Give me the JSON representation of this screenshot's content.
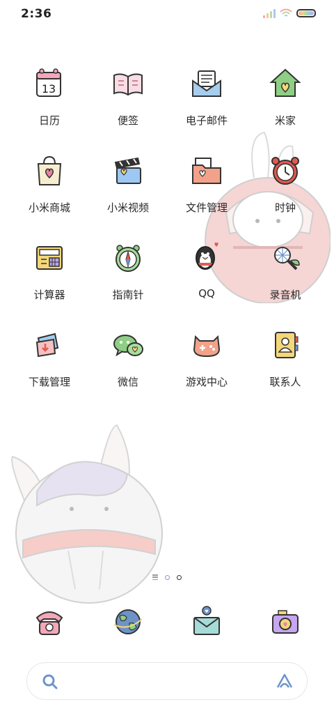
{
  "status_bar": {
    "time": "2:36",
    "icons": [
      "signal-icon",
      "wifi-icon",
      "battery-icon"
    ]
  },
  "apps": [
    {
      "label": "日历",
      "icon": "calendar-icon",
      "day": "13"
    },
    {
      "label": "便签",
      "icon": "notes-icon"
    },
    {
      "label": "电子邮件",
      "icon": "email-icon"
    },
    {
      "label": "米家",
      "icon": "smart-home-icon"
    },
    {
      "label": "小米商城",
      "icon": "store-bag-icon"
    },
    {
      "label": "小米视频",
      "icon": "video-clapper-icon"
    },
    {
      "label": "文件管理",
      "icon": "folder-icon"
    },
    {
      "label": "时钟",
      "icon": "alarm-clock-icon"
    },
    {
      "label": "计算器",
      "icon": "calculator-icon"
    },
    {
      "label": "指南针",
      "icon": "compass-icon"
    },
    {
      "label": "QQ",
      "icon": "penguin-icon"
    },
    {
      "label": "录音机",
      "icon": "microphone-icon"
    },
    {
      "label": "下载管理",
      "icon": "download-icon"
    },
    {
      "label": "微信",
      "icon": "chat-bubbles-icon"
    },
    {
      "label": "游戏中心",
      "icon": "game-controller-icon"
    },
    {
      "label": "联系人",
      "icon": "contacts-book-icon"
    }
  ],
  "dock": [
    {
      "icon": "phone-icon"
    },
    {
      "icon": "globe-browser-icon"
    },
    {
      "icon": "messages-envelope-icon"
    },
    {
      "icon": "camera-icon"
    }
  ],
  "page_indicator": {
    "pages": 3,
    "current": 3
  },
  "search": {
    "icons": [
      "search-icon",
      "assistant-icon"
    ]
  },
  "colors": {
    "accent_blue": "#6e93c9",
    "pink": "#f4a7b9",
    "green": "#8fcf85",
    "yellow": "#f4d77a"
  }
}
